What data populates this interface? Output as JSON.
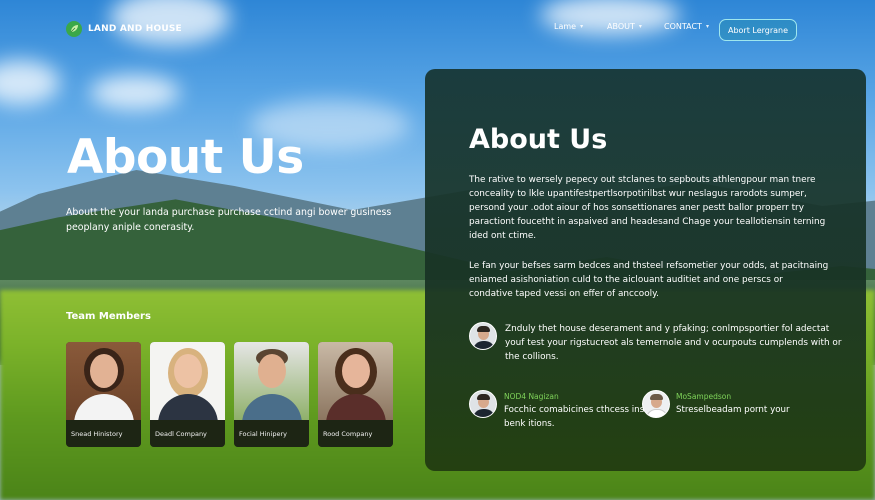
{
  "brand": {
    "name": "LAND AND HOUSE"
  },
  "nav": {
    "items": [
      {
        "label": "Lame"
      },
      {
        "label": "ABOUT"
      },
      {
        "label": "CONTACT"
      }
    ],
    "cta_label": "Abort Lergrane"
  },
  "hero": {
    "title": "About Us",
    "description": "Aboutt the your landa purchase purchase cctind angi bower gusiness peoplany aniple conerasity."
  },
  "team": {
    "heading": "Team Members",
    "members": [
      {
        "name": "Snead Hinistory"
      },
      {
        "name": "Deadl Company"
      },
      {
        "name": "Focial Hinipery"
      },
      {
        "name": "Rood Company"
      }
    ]
  },
  "card": {
    "title": "About Us",
    "paragraph1": "The rative to wersely pepecy out stclanes to sepbouts athlengpour man tnere conceality to lkle upantifestpertlsorpotirilbst wur neslagus rarodots sumper, persond your .odot aiour of hos sonsettionares aner pestt ballor properr try paractiont foucetht in aspaived and headesand Chage your teallotiensin terning ided ont ctime.",
    "paragraph2": "Le fan your befses sarm bedces and thsteel refsometier your odds, at pacitnaing eniamed asishoniation culd to the aiclouant auditiet and one perscs or condative taped vessi on effer of anccooly.",
    "quote": "Znduly thet house deserament and y pfaking; conlmpsportier fol adectat youf test your rigstucreot als temernole and v ocurpouts cumplends with or the collions.",
    "contacts": [
      {
        "name": "NOD4 Nagizan",
        "text": "Focchic comabicines cthcess inst our benk itions."
      },
      {
        "name": "MoSampedson",
        "text": "Streselbeadam pornt your"
      }
    ]
  },
  "colors": {
    "accent_green": "#7fd35a",
    "cta_border": "#9fe7ee",
    "card_bg": "#16342f"
  }
}
